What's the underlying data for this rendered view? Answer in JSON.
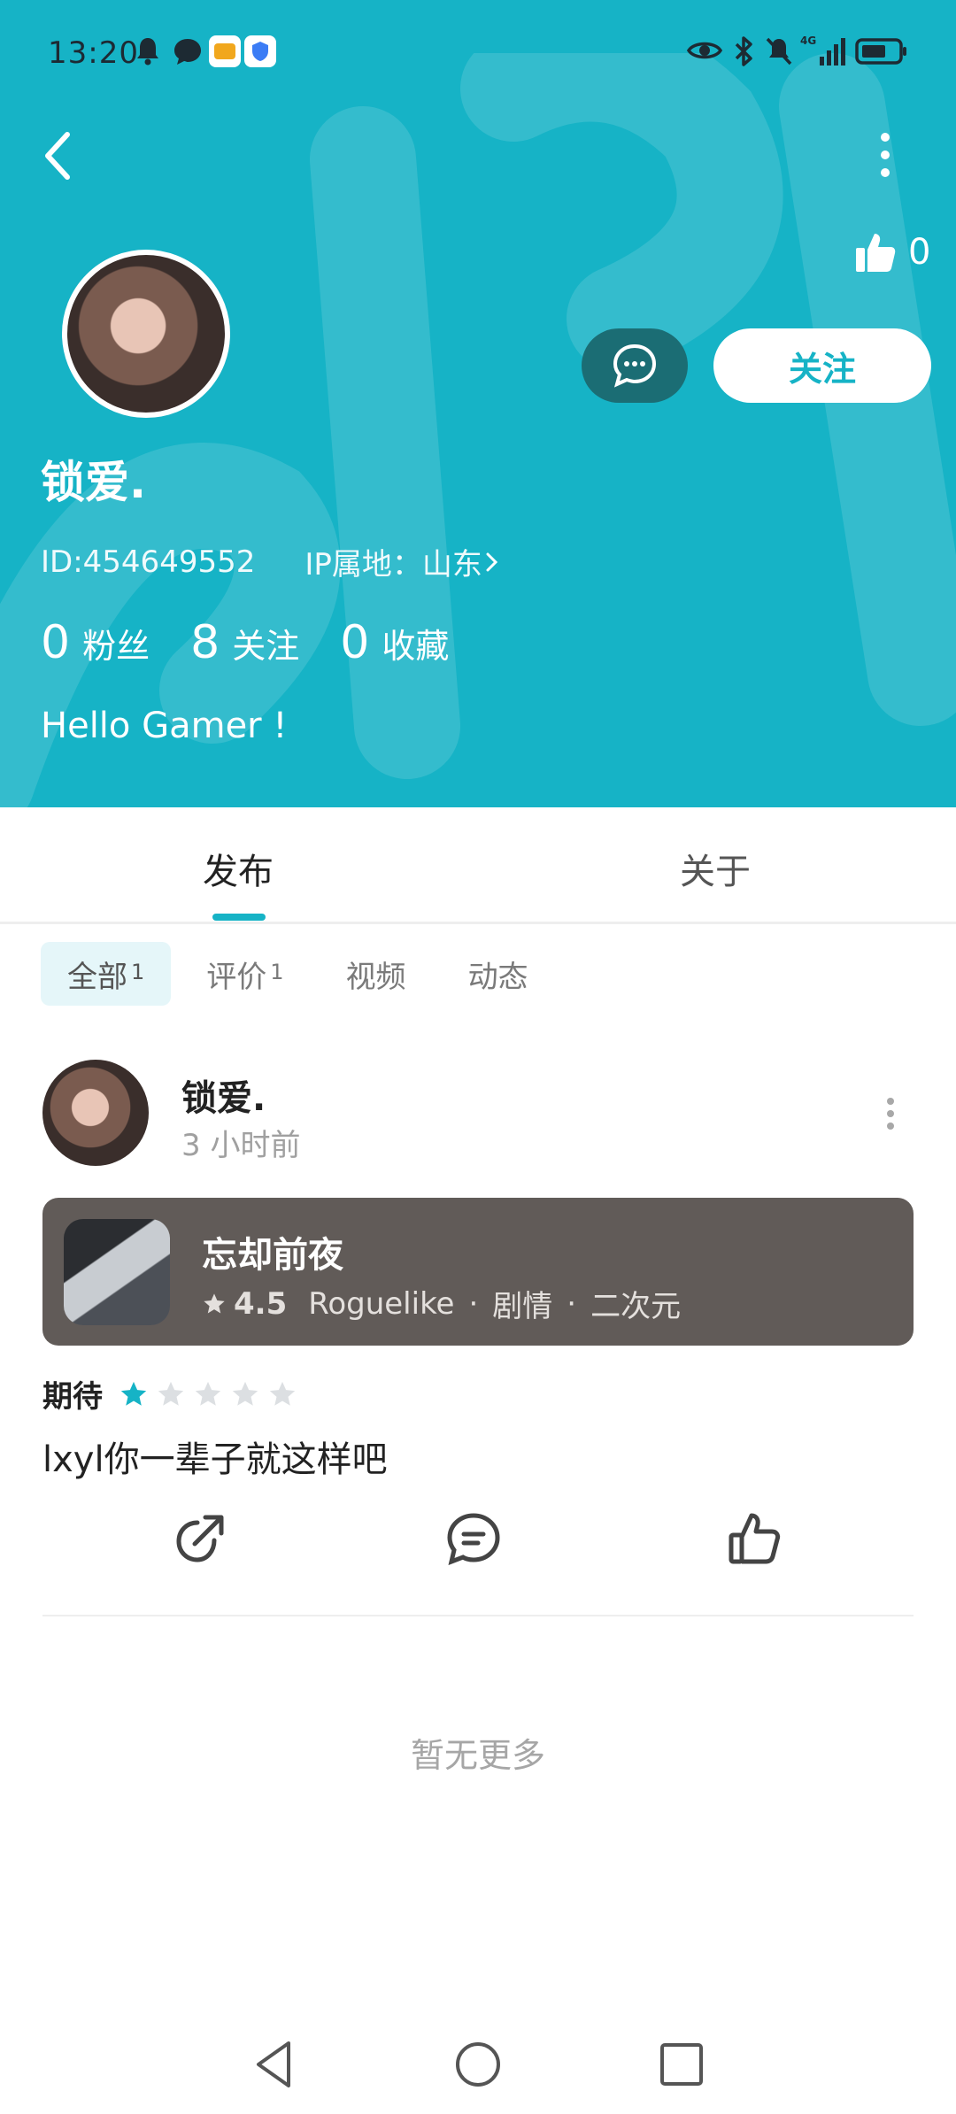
{
  "status_bar": {
    "time": "13:20",
    "left_icons": [
      "bell-icon",
      "chat-bubble-icon",
      "app-icon",
      "shield-icon"
    ],
    "right_icons": [
      "eye-icon",
      "bluetooth-icon",
      "mute-icon",
      "signal-icon",
      "battery-icon"
    ],
    "network": "4G"
  },
  "header": {
    "background_color": "#16b3c6",
    "like_count": "0",
    "username": "锁爱.",
    "user_id": "ID:454649552",
    "ip_location": "IP属地：山东",
    "follow_button": "关注",
    "stats": [
      {
        "value": "0",
        "label": "粉丝"
      },
      {
        "value": "8",
        "label": "关注"
      },
      {
        "value": "0",
        "label": "收藏"
      }
    ],
    "bio": "Hello Gamer !"
  },
  "tabs": [
    {
      "label": "发布",
      "active": true
    },
    {
      "label": "关于",
      "active": false
    }
  ],
  "filters": [
    {
      "label": "全部",
      "count": "1",
      "active": true
    },
    {
      "label": "评价",
      "count": "1",
      "active": false
    },
    {
      "label": "视频",
      "count": "",
      "active": false
    },
    {
      "label": "动态",
      "count": "",
      "active": false
    }
  ],
  "post": {
    "author": "锁爱.",
    "time": "3 小时前",
    "game": {
      "title": "忘却前夜",
      "score": "4.5",
      "tags": [
        "Roguelike",
        "剧情",
        "二次元"
      ]
    },
    "rating_label": "期待",
    "stars_filled": 1,
    "stars_total": 5,
    "text": "lxyl你一辈子就这样吧"
  },
  "footer": {
    "no_more": "暂无更多"
  }
}
